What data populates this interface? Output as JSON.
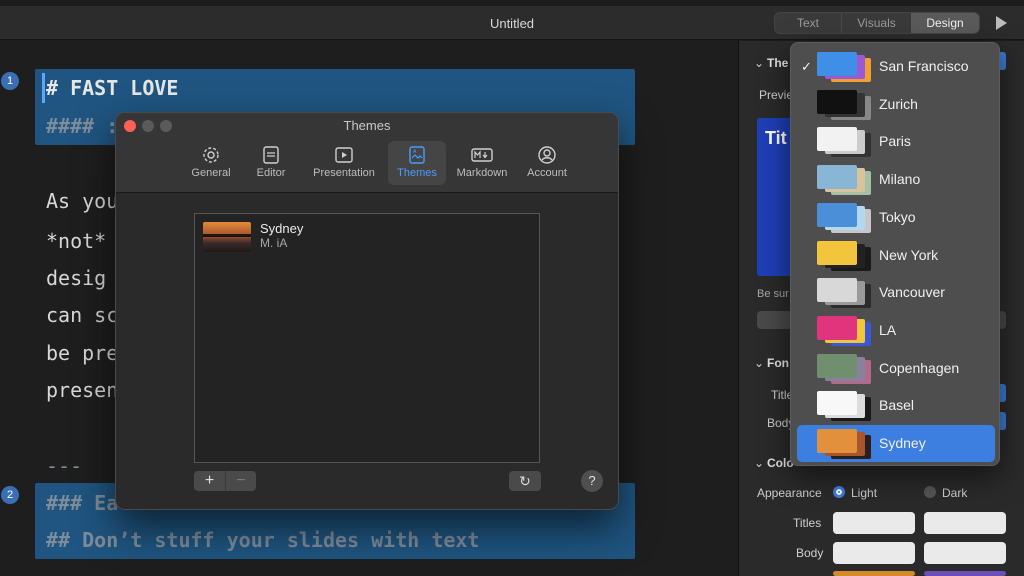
{
  "window": {
    "title": "Untitled"
  },
  "top_tabs": [
    "Text",
    "Visuals",
    "Design"
  ],
  "editor": {
    "badge1": "1",
    "badge2": "2",
    "line1": "# FAST LOVE",
    "line2": "#### :",
    "body": [
      "As you",
      "*not*",
      "desig",
      "can sc",
      "be pre",
      "presen"
    ],
    "separator": "---",
    "line_h3": "### Ea",
    "line_h2": "## Don’t stuff your slides with text"
  },
  "themes_dialog": {
    "title": "Themes",
    "tabs": [
      {
        "label": "General",
        "icon": "gear-icon"
      },
      {
        "label": "Editor",
        "icon": "editor-icon"
      },
      {
        "label": "Presentation",
        "icon": "presentation-icon"
      },
      {
        "label": "Themes",
        "icon": "themes-icon"
      },
      {
        "label": "Markdown",
        "icon": "markdown-icon"
      },
      {
        "label": "Account",
        "icon": "account-icon"
      }
    ],
    "theme_item": {
      "name": "Sydney",
      "author": "M. iA"
    },
    "add_label": "+",
    "remove_label": "−",
    "reset_label": "↻",
    "help_label": "?"
  },
  "panel": {
    "theme_heading": "The",
    "preview_label": "Previe",
    "preview_title": "Tit",
    "be_sure_text": "Be sur",
    "fonts_heading": "Fon",
    "titles_short": "Title",
    "body_short": "Body",
    "colors_heading": "Colo",
    "appearance_label": "Appearance",
    "light_label": "Light",
    "dark_label": "Dark",
    "titles_label": "Titles",
    "body_label": "Body"
  },
  "theme_menu": {
    "checked": "San Francisco",
    "highlighted": "Sydney",
    "items": [
      {
        "label": "San Francisco",
        "c1": "#f0a030",
        "c2": "#9b59d6",
        "c3": "#3f8fe8"
      },
      {
        "label": "Zurich",
        "c1": "#888888",
        "c2": "#333333",
        "c3": "#111111"
      },
      {
        "label": "Paris",
        "c1": "#333333",
        "c2": "#cccccc",
        "c3": "#f2f2f2"
      },
      {
        "label": "Milano",
        "c1": "#a6c0a6",
        "c2": "#d8c39a",
        "c3": "#8ab6d6"
      },
      {
        "label": "Tokyo",
        "c1": "#c7c7c7",
        "c2": "#b5d7f0",
        "c3": "#4a8fd8"
      },
      {
        "label": "New York",
        "c1": "#1a1a1a",
        "c2": "#222222",
        "c3": "#f2c53c"
      },
      {
        "label": "Vancouver",
        "c1": "#2c2c2c",
        "c2": "#9a9a9a",
        "c3": "#d8d8d8"
      },
      {
        "label": "LA",
        "c1": "#3a57d8",
        "c2": "#f0c63a",
        "c3": "#e0357d"
      },
      {
        "label": "Copenhagen",
        "c1": "#b06a8a",
        "c2": "#8a7fa0",
        "c3": "#6f8f6f"
      },
      {
        "label": "Basel",
        "c1": "#1a1a1a",
        "c2": "#dcdcdc",
        "c3": "#f8f8f8"
      },
      {
        "label": "Sydney",
        "c1": "#2a1e1e",
        "c2": "#a8542c",
        "c3": "#e3903c"
      }
    ]
  }
}
